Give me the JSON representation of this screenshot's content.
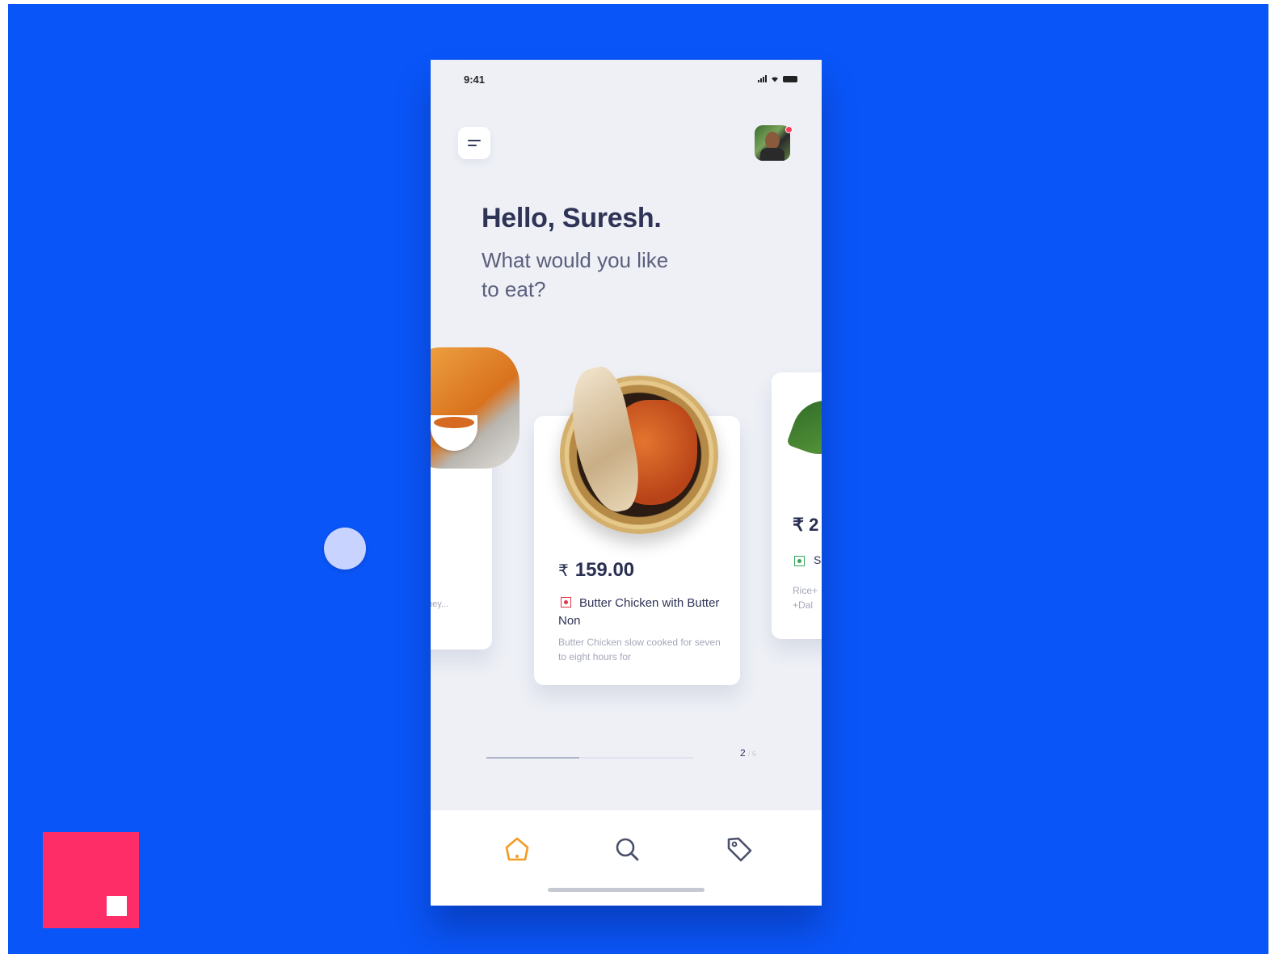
{
  "status_bar": {
    "time": "9:41"
  },
  "header": {
    "menu_icon": "menu-icon",
    "avatar_icon": "user-avatar"
  },
  "greeting": {
    "title": "Hello, Suresh.",
    "subtitle": "What would you like to eat?"
  },
  "carousel": {
    "active_card": {
      "currency": "₹",
      "price": "159.00",
      "type": "non-veg",
      "name": "Butter Chicken with Butter Non",
      "description": "Butter Chicken slow cooked for seven to eight hours for"
    },
    "left_card": {
      "desc_line1": "·",
      "desc_line2": "ney..."
    },
    "right_card": {
      "price_visible": "₹ 2",
      "type": "veg",
      "name_visible": "S",
      "desc_line1": "Rice+",
      "desc_line2": "+Dal"
    },
    "progress": 0.45,
    "pager": {
      "current": "2",
      "total": "/ 6"
    }
  },
  "bottom_nav": {
    "items": [
      {
        "icon": "home-icon",
        "active": true
      },
      {
        "icon": "search-icon",
        "active": false
      },
      {
        "icon": "tag-icon",
        "active": false
      }
    ]
  },
  "colors": {
    "background": "#0a55f8",
    "accent": "#f59a23",
    "brand_square": "#ff2d67",
    "title": "#2f3356",
    "nonveg": "#e2364a",
    "veg": "#35a55b"
  }
}
